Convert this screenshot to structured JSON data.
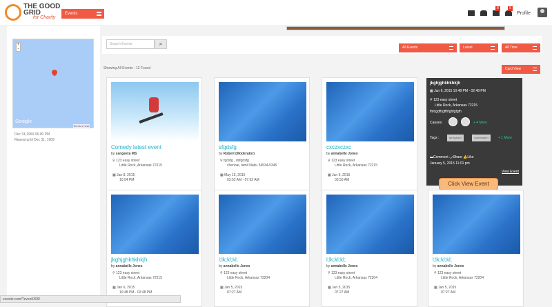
{
  "header": {
    "logo_text_line1": "THE GOOD",
    "logo_text_line2": "GRID",
    "logo_sub": "for Charity",
    "events_select": "Events",
    "badge_messages": "8",
    "badge_notifications": "5",
    "profile_label": "Profile"
  },
  "left": {
    "google_label": "Google",
    "terms_label": "Terms of Use",
    "date_line1": "Dec 31,1969 06:00 PM",
    "date_line2": "Repeat until Dec 31, 1969",
    "zoom_in": "+",
    "zoom_out": "-"
  },
  "filters": {
    "search_placeholder": "Search Events",
    "search_button": "⌕",
    "all_events": "All Events",
    "latest": "Latest",
    "all_time": "All Time",
    "card_view": "Card View"
  },
  "showing_text": "Showing All Events - 12 Found",
  "cards": [
    {
      "title": "Comedy latest event",
      "by_prefix": "by",
      "author": "sangeeta MS",
      "addr1": "123 easy street",
      "addr2": "Little Rock, Arkansas 72215",
      "date": "Jan 8, 2015",
      "time": "10:54 PM"
    },
    {
      "title": "sfgdsfg",
      "by_prefix": "by",
      "author": "Robert (Moderator)",
      "addr1": "fgdsfg , dsfgdsfg",
      "addr2": "chennai, tamil Nadu 34534-5345",
      "date": "May 15, 2015",
      "time": "03:52 AM - 07:52 AM"
    },
    {
      "title": "cxczxczxc",
      "by_prefix": "by",
      "author": "annabelle Jones",
      "addr1": "123 easy street",
      "addr2": "Little Rock, Arkansas 72215",
      "date": "Jan 6, 2015",
      "time": "03:50 AM"
    },
    {
      "title": "jkghjghkhkhkjh",
      "by_prefix": "by",
      "author": "annabelle Jones",
      "addr1": "123 easy street",
      "addr2": "Little Rock, Arkansas 72215",
      "date": "Jan 6, 2015",
      "time": "10:48 PM - 02:48 PM"
    },
    {
      "title": "l;lk;kl;kl;",
      "by_prefix": "by",
      "author": "annabelle Jones",
      "addr1": "123 easy street",
      "addr2": "Little Rock, Arkansas 72204",
      "date": "Jan 5, 2015",
      "time": "07:27 AM"
    },
    {
      "title": "l;lk;kl;kl;",
      "by_prefix": "by",
      "author": "annabelle Jones",
      "addr1": "123 easy street",
      "addr2": "Little Rock, Arkansas 72204",
      "date": "Jan 5, 2015",
      "time": "07:27 AM"
    },
    {
      "title": "l;lk;kl;kl;",
      "by_prefix": "by",
      "author": "annabelle Jones",
      "addr1": "123 easy street",
      "addr2": "Little Rock, Arkansas 72204",
      "date": "Jan 5, 2015",
      "time": "07:27 AM"
    }
  ],
  "popup": {
    "title": "jkghjghkhkhkjh",
    "datetime": "Jan 6, 2015 10:48 PM - 02:48 PM",
    "addr1": "123 easy street",
    "addr2": "Little Rock, Arkansas 72215",
    "desc": "fhfdgdfhgffhfghfgfgfh",
    "causes_label": "Causes:",
    "causes_more": "+ 4 More",
    "tags_label": "Tags :",
    "tag1": "fghfgdfgfd",
    "tag2": "xcbbbbgfhn",
    "tags_more": "+ 1 More",
    "comment": "Comment",
    "share": "Share",
    "like": "Like",
    "posted": "January 5, 2015 11:01 pm",
    "view_event": "View Event"
  },
  "callout": "Click View Event",
  "status_url": "coexist.com/?event/309/"
}
